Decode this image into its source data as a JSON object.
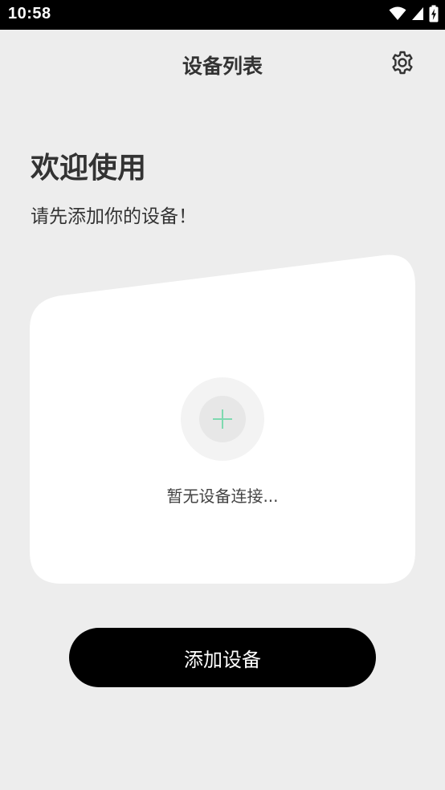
{
  "status_bar": {
    "time": "10:58",
    "icons": [
      "wifi-icon",
      "signal-icon",
      "battery-charging-icon"
    ]
  },
  "app_bar": {
    "title": "设备列表",
    "settings_icon": "gear-icon"
  },
  "welcome": {
    "title": "欢迎使用",
    "subtitle": "请先添加你的设备！"
  },
  "device_card": {
    "add_icon": "plus-icon",
    "empty_text": "暂无设备连接..."
  },
  "actions": {
    "add_device_label": "添加设备"
  },
  "colors": {
    "background": "#ededed",
    "card": "#ffffff",
    "accent_plus": "#7fd9b0",
    "button": "#000000",
    "button_text": "#ffffff"
  }
}
